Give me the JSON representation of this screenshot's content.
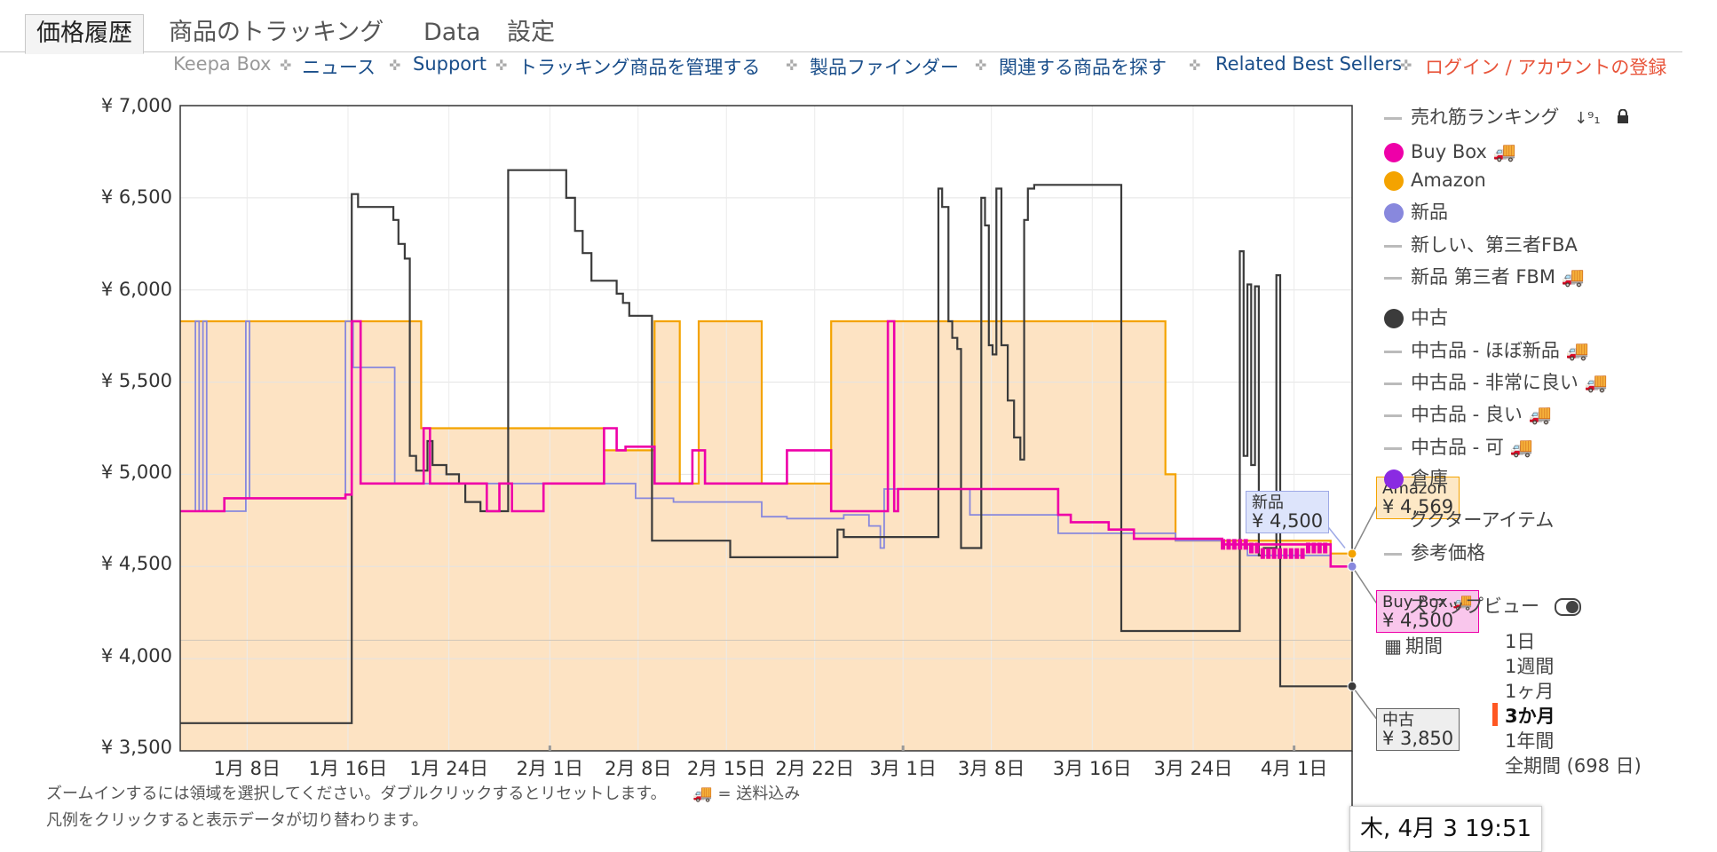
{
  "tabs": [
    {
      "label": "価格履歴",
      "active": true
    },
    {
      "label": "商品のトラッキング",
      "active": false
    },
    {
      "label": "Data",
      "active": false
    },
    {
      "label": "設定",
      "active": false
    }
  ],
  "nav": {
    "items": [
      "Keepa Box",
      "ニュース",
      "Support",
      "トラッキング商品を管理する",
      "製品ファインダー",
      "関連する商品を探す",
      "Related Best Sellers",
      "ログイン / アカウントの登録"
    ],
    "colors": {
      "muted": "#999999",
      "link": "#1a4e8a",
      "login": "#e8553b"
    }
  },
  "legend": {
    "items": [
      {
        "label": "売れ筋ランキング",
        "marker": "dash",
        "extra_icons": [
          "sort-numeric-icon",
          "lock-icon"
        ]
      },
      {
        "label": "Buy Box 🚚",
        "marker": "dot",
        "color": "#ee00a8"
      },
      {
        "label": "Amazon",
        "marker": "dot",
        "color": "#f4a300"
      },
      {
        "label": "新品",
        "marker": "dot",
        "color": "#8888dd"
      },
      {
        "label": "新しい、第三者FBA",
        "marker": "dash"
      },
      {
        "label": "新品 第三者 FBM 🚚",
        "marker": "dash"
      },
      {
        "label": "中古",
        "marker": "dot",
        "color": "#3b3b3b"
      },
      {
        "label": "中古品 - ほぼ新品 🚚",
        "marker": "dash"
      },
      {
        "label": "中古品 - 非常に良い 🚚",
        "marker": "dash"
      },
      {
        "label": "中古品 - 良い 🚚",
        "marker": "dash"
      },
      {
        "label": "中古品 - 可 🚚",
        "marker": "dash"
      },
      {
        "label": "倉庫",
        "marker": "dot",
        "color": "#8a2be2"
      },
      {
        "label": "ククターアイテム",
        "marker": "none"
      },
      {
        "label": "参考価格",
        "marker": "dash"
      },
      {
        "label": "ズアップビュー",
        "marker": "none",
        "toggle": true
      },
      {
        "label": "期間",
        "marker": "calendar"
      }
    ]
  },
  "ranges": {
    "items": [
      "1日",
      "1週間",
      "1ヶ月",
      "3か月",
      "1年間",
      "全期間 (698 日)"
    ],
    "selected": "3か月",
    "accent": "#ff5722"
  },
  "tooltips": {
    "new": {
      "title": "新品",
      "value": "¥ 4,500",
      "bg": "#dde4fb",
      "border": "#9ea9e6"
    },
    "amazon": {
      "title": "Amazon",
      "value": "¥ 4,569",
      "bg": "#fde8c6",
      "border": "#f4a300"
    },
    "buybox": {
      "title": "Buy Box 🚚",
      "value": "¥ 4,500",
      "bg": "#f9c6ec",
      "border": "#ee00a8"
    },
    "used": {
      "title": "中古",
      "value": "¥ 3,850",
      "bg": "#eeeeee",
      "border": "#666666"
    }
  },
  "help": {
    "line1_a": "ズームインするには領域を選択してください。ダブルクリックするとリセットします。",
    "line1_b": "🚚 = 送料込み",
    "line2": "凡例をクリックすると表示データが切り替わります。"
  },
  "timestamp": "木, 4月 3 19:51",
  "chart_data": {
    "type": "line",
    "title": "",
    "xlabel": "",
    "ylabel": "",
    "y_tick_labels": [
      "¥ 3,500",
      "¥ 4,000",
      "¥ 4,500",
      "¥ 5,000",
      "¥ 5,500",
      "¥ 6,000",
      "¥ 6,500",
      "¥ 7,000"
    ],
    "y_ticks": [
      3500,
      4000,
      4500,
      5000,
      5500,
      6000,
      6500,
      7000
    ],
    "ylim": [
      3500,
      7000
    ],
    "xlim": [
      2.7,
      95.6
    ],
    "x_axis_note": "day index, 1 = Jan 1",
    "x_ticks": [
      {
        "label": "1月 8日",
        "day": 8
      },
      {
        "label": "1月 16日",
        "day": 16
      },
      {
        "label": "1月 24日",
        "day": 24
      },
      {
        "label": "2月 1日",
        "day": 32
      },
      {
        "label": "2月 8日",
        "day": 39
      },
      {
        "label": "2月 15日",
        "day": 46
      },
      {
        "label": "2月 22日",
        "day": 53
      },
      {
        "label": "3月 1日",
        "day": 60
      },
      {
        "label": "3月 8日",
        "day": 67
      },
      {
        "label": "3月 16日",
        "day": 75
      },
      {
        "label": "3月 24日",
        "day": 83
      },
      {
        "label": "4月 1日",
        "day": 91
      }
    ],
    "grid": true,
    "legend_position": "right",
    "series": [
      {
        "name": "Amazon",
        "color": "#f4a300",
        "fill": "#fde3c3",
        "step": true,
        "points": [
          [
            2.7,
            5830
          ],
          [
            21.8,
            5830
          ],
          [
            21.8,
            5250
          ],
          [
            36.3,
            5250
          ],
          [
            36.3,
            5130
          ],
          [
            40.3,
            5130
          ],
          [
            40.3,
            5830
          ],
          [
            42.3,
            5830
          ],
          [
            42.3,
            4950
          ],
          [
            43.8,
            4950
          ],
          [
            43.8,
            5830
          ],
          [
            48.8,
            5830
          ],
          [
            48.8,
            4950
          ],
          [
            54.3,
            4950
          ],
          [
            54.3,
            5830
          ],
          [
            80.8,
            5830
          ],
          [
            80.8,
            5000
          ],
          [
            81.6,
            5000
          ],
          [
            81.6,
            4640
          ],
          [
            93.9,
            4640
          ],
          [
            93.9,
            4570
          ],
          [
            95.6,
            4570
          ]
        ]
      },
      {
        "name": "新品",
        "color": "#8888dd",
        "step": true,
        "points": [
          [
            2.7,
            4800
          ],
          [
            3.9,
            4800
          ],
          [
            3.9,
            5830
          ],
          [
            4.2,
            5830
          ],
          [
            4.2,
            4800
          ],
          [
            4.5,
            4800
          ],
          [
            4.5,
            5830
          ],
          [
            4.8,
            5830
          ],
          [
            4.8,
            4800
          ],
          [
            7.9,
            4800
          ],
          [
            7.9,
            5830
          ],
          [
            8.2,
            5830
          ],
          [
            8.2,
            4870
          ],
          [
            15.8,
            4870
          ],
          [
            15.8,
            5830
          ],
          [
            16.4,
            5830
          ],
          [
            16.4,
            5580
          ],
          [
            19.7,
            5580
          ],
          [
            19.7,
            4950
          ],
          [
            36.3,
            4950
          ],
          [
            36.3,
            4950
          ],
          [
            38.8,
            4950
          ],
          [
            38.8,
            4870
          ],
          [
            41.8,
            4870
          ],
          [
            41.8,
            4850
          ],
          [
            48.8,
            4850
          ],
          [
            48.8,
            4770
          ],
          [
            50.8,
            4770
          ],
          [
            50.8,
            4760
          ],
          [
            55.3,
            4760
          ],
          [
            55.3,
            4780
          ],
          [
            57.3,
            4780
          ],
          [
            57.3,
            4720
          ],
          [
            58.2,
            4720
          ],
          [
            58.2,
            4600
          ],
          [
            58.5,
            4600
          ],
          [
            58.5,
            4920
          ],
          [
            65.3,
            4920
          ],
          [
            65.3,
            4780
          ],
          [
            72.3,
            4780
          ],
          [
            72.3,
            4680
          ],
          [
            81.6,
            4680
          ],
          [
            81.6,
            4640
          ],
          [
            85.3,
            4640
          ],
          [
            85.3,
            4620
          ],
          [
            87.3,
            4620
          ],
          [
            87.3,
            4560
          ],
          [
            93.9,
            4560
          ],
          [
            93.9,
            4500
          ],
          [
            95.6,
            4500
          ]
        ]
      },
      {
        "name": "Buy Box 🚚",
        "color": "#ee00a8",
        "step": true,
        "points": [
          [
            2.7,
            4800
          ],
          [
            6.2,
            4800
          ],
          [
            6.2,
            4870
          ],
          [
            15.8,
            4870
          ],
          [
            15.8,
            4890
          ],
          [
            16.3,
            4890
          ],
          [
            16.3,
            5830
          ],
          [
            17.0,
            5830
          ],
          [
            17.0,
            4950
          ],
          [
            22.0,
            4950
          ],
          [
            22.0,
            5250
          ],
          [
            22.5,
            5250
          ],
          [
            22.5,
            4950
          ],
          [
            27.0,
            4950
          ],
          [
            27.0,
            4800
          ],
          [
            28.0,
            4800
          ],
          [
            28.0,
            4950
          ],
          [
            29.0,
            4950
          ],
          [
            29.0,
            4800
          ],
          [
            31.5,
            4800
          ],
          [
            31.5,
            4950
          ],
          [
            36.3,
            4950
          ],
          [
            36.3,
            5250
          ],
          [
            37.3,
            5250
          ],
          [
            37.3,
            5130
          ],
          [
            38.0,
            5130
          ],
          [
            38.0,
            5150
          ],
          [
            40.3,
            5150
          ],
          [
            40.3,
            4950
          ],
          [
            43.3,
            4950
          ],
          [
            43.3,
            5130
          ],
          [
            44.3,
            5130
          ],
          [
            44.3,
            4950
          ],
          [
            50.8,
            4950
          ],
          [
            50.8,
            5130
          ],
          [
            54.3,
            5130
          ],
          [
            54.3,
            4800
          ],
          [
            58.8,
            4800
          ],
          [
            58.8,
            5830
          ],
          [
            59.3,
            5830
          ],
          [
            59.3,
            4800
          ],
          [
            59.6,
            4800
          ],
          [
            59.6,
            4920
          ],
          [
            72.3,
            4920
          ],
          [
            72.3,
            4780
          ],
          [
            73.3,
            4780
          ],
          [
            73.3,
            4740
          ],
          [
            76.3,
            4740
          ],
          [
            76.3,
            4700
          ],
          [
            78.3,
            4700
          ],
          [
            78.3,
            4650
          ],
          [
            85.3,
            4650
          ],
          [
            85.3,
            4620
          ],
          [
            93.9,
            4620
          ],
          [
            93.9,
            4500
          ],
          [
            95.6,
            4500
          ]
        ]
      },
      {
        "name": "中古",
        "color": "#3b3b3b",
        "step": true,
        "points": [
          [
            2.7,
            3650
          ],
          [
            16.3,
            3650
          ],
          [
            16.3,
            6520
          ],
          [
            16.8,
            6520
          ],
          [
            16.8,
            6450
          ],
          [
            19.6,
            6450
          ],
          [
            19.6,
            6380
          ],
          [
            20.0,
            6380
          ],
          [
            20.0,
            6250
          ],
          [
            20.5,
            6250
          ],
          [
            20.5,
            6170
          ],
          [
            20.9,
            6170
          ],
          [
            20.9,
            5100
          ],
          [
            21.4,
            5100
          ],
          [
            21.4,
            5020
          ],
          [
            22.3,
            5020
          ],
          [
            22.3,
            5180
          ],
          [
            22.7,
            5180
          ],
          [
            22.7,
            5050
          ],
          [
            23.8,
            5050
          ],
          [
            23.8,
            5000
          ],
          [
            24.8,
            5000
          ],
          [
            24.8,
            4950
          ],
          [
            25.3,
            4950
          ],
          [
            25.3,
            4850
          ],
          [
            26.5,
            4850
          ],
          [
            26.5,
            4800
          ],
          [
            28.3,
            4800
          ],
          [
            28.3,
            4800
          ],
          [
            28.7,
            4800
          ],
          [
            28.7,
            6650
          ],
          [
            33.3,
            6650
          ],
          [
            33.3,
            6500
          ],
          [
            34.0,
            6500
          ],
          [
            34.0,
            6320
          ],
          [
            34.6,
            6320
          ],
          [
            34.6,
            6200
          ],
          [
            35.3,
            6200
          ],
          [
            35.3,
            6050
          ],
          [
            37.3,
            6050
          ],
          [
            37.3,
            5980
          ],
          [
            37.8,
            5980
          ],
          [
            37.8,
            5930
          ],
          [
            38.3,
            5930
          ],
          [
            38.3,
            5860
          ],
          [
            40.1,
            5860
          ],
          [
            40.1,
            4640
          ],
          [
            46.3,
            4640
          ],
          [
            46.3,
            4550
          ],
          [
            54.8,
            4550
          ],
          [
            54.8,
            4700
          ],
          [
            55.3,
            4700
          ],
          [
            55.3,
            4660
          ],
          [
            62.8,
            4660
          ],
          [
            62.8,
            6550
          ],
          [
            63.1,
            6550
          ],
          [
            63.1,
            6450
          ],
          [
            63.6,
            6450
          ],
          [
            63.6,
            5830
          ],
          [
            63.9,
            5830
          ],
          [
            63.9,
            5740
          ],
          [
            64.3,
            5740
          ],
          [
            64.3,
            5680
          ],
          [
            64.6,
            5680
          ],
          [
            64.6,
            4600
          ],
          [
            66.2,
            4600
          ],
          [
            66.2,
            6500
          ],
          [
            66.5,
            6500
          ],
          [
            66.5,
            6350
          ],
          [
            66.8,
            6350
          ],
          [
            66.8,
            5700
          ],
          [
            67.1,
            5700
          ],
          [
            67.1,
            5650
          ],
          [
            67.4,
            5650
          ],
          [
            67.4,
            6550
          ],
          [
            67.8,
            6550
          ],
          [
            67.8,
            5700
          ],
          [
            68.3,
            5700
          ],
          [
            68.3,
            5400
          ],
          [
            68.8,
            5400
          ],
          [
            68.8,
            5200
          ],
          [
            69.3,
            5200
          ],
          [
            69.3,
            5080
          ],
          [
            69.6,
            5080
          ],
          [
            69.6,
            6380
          ],
          [
            69.9,
            6380
          ],
          [
            69.9,
            6550
          ],
          [
            70.4,
            6550
          ],
          [
            70.4,
            6570
          ],
          [
            77.3,
            6570
          ],
          [
            77.3,
            4150
          ],
          [
            86.7,
            4150
          ],
          [
            86.7,
            6210
          ],
          [
            87.0,
            6210
          ],
          [
            87.0,
            5100
          ],
          [
            87.3,
            5100
          ],
          [
            87.3,
            6030
          ],
          [
            87.6,
            6030
          ],
          [
            87.6,
            5050
          ],
          [
            87.9,
            5050
          ],
          [
            87.9,
            6020
          ],
          [
            88.2,
            6020
          ],
          [
            88.2,
            4560
          ],
          [
            88.6,
            4560
          ],
          [
            88.6,
            4600
          ],
          [
            89.6,
            4600
          ],
          [
            89.6,
            6080
          ],
          [
            89.9,
            6080
          ],
          [
            89.9,
            3850
          ],
          [
            95.6,
            3850
          ]
        ]
      }
    ]
  }
}
